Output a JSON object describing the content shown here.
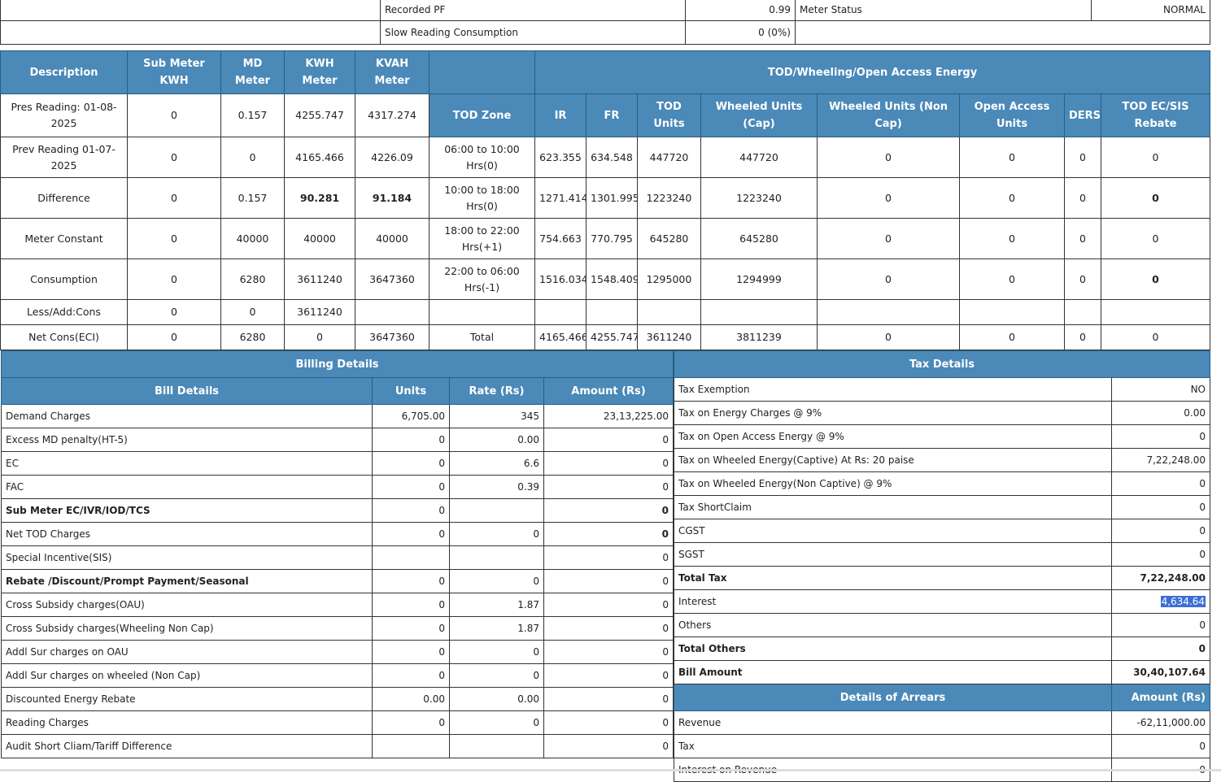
{
  "summary": {
    "rows": [
      {
        "label": "Recorded PF",
        "value": "0.99",
        "label2": "Meter Status",
        "value2": "NORMAL"
      },
      {
        "label": "Slow Reading Consumption",
        "value": "0 (0%)"
      }
    ]
  },
  "energy": {
    "headers": {
      "description": "Description",
      "sub_meter": "Sub Meter KWH",
      "md": "MD Meter",
      "kwh": "KWH Meter",
      "kvah": "KVAH Meter",
      "tod_group": "TOD/Wheeling/Open Access Energy",
      "tod_zone": "TOD Zone",
      "ir": "IR",
      "fr": "FR",
      "tod_units": "TOD Units",
      "wheeled_cap": "Wheeled Units (Cap)",
      "wheeled_noncap": "Wheeled Units (Non Cap)",
      "open_access": "Open Access Units",
      "ders": "DERS",
      "rebate": "TOD EC/SIS Rebate"
    },
    "pres": {
      "description": "Pres Reading: 01-08-2025",
      "sub_meter": "0",
      "md": "0.157",
      "kwh": "4255.747",
      "kvah": "4317.274"
    },
    "rows": [
      {
        "description": "Prev Reading 01-07-2025",
        "sub_meter": "0",
        "md": "0",
        "kwh": "4165.466",
        "kvah": "4226.09",
        "zone": "06:00  to 10:00 Hrs(0)",
        "ir": "623.355",
        "fr": "634.548",
        "tod": "447720",
        "wcap": "447720",
        "wnon": "0",
        "oa": "0",
        "ders": "0",
        "rebate": "0"
      },
      {
        "description": "Difference",
        "sub_meter": "0",
        "md": "0.157",
        "kwh": "90.281",
        "kvah": "91.184",
        "zone": "10:00  to 18:00 Hrs(0)",
        "ir": "1271.414",
        "fr": "1301.995",
        "tod": "1223240",
        "wcap": "1223240",
        "wnon": "0",
        "oa": "0",
        "ders": "0",
        "rebate": "0"
      },
      {
        "description": "Meter Constant",
        "sub_meter": "0",
        "md": "40000",
        "kwh": "40000",
        "kvah": "40000",
        "zone": "18:00  to 22:00 Hrs(+1)",
        "ir": "754.663",
        "fr": "770.795",
        "tod": "645280",
        "wcap": "645280",
        "wnon": "0",
        "oa": "0",
        "ders": "0",
        "rebate": "0"
      },
      {
        "description": "Consumption",
        "sub_meter": "0",
        "md": "6280",
        "kwh": "3611240",
        "kvah": "3647360",
        "zone": "22:00  to 06:00 Hrs(-1)",
        "ir": "1516.034",
        "fr": "1548.409",
        "tod": "1295000",
        "wcap": "1294999",
        "wnon": "0",
        "oa": "0",
        "ders": "0",
        "rebate": "0"
      },
      {
        "description": "Less/Add:Cons",
        "sub_meter": "0",
        "md": "0",
        "kwh": "3611240",
        "kvah": "",
        "zone": "",
        "ir": "",
        "fr": "",
        "tod": "",
        "wcap": "",
        "wnon": "",
        "oa": "",
        "ders": "",
        "rebate": ""
      },
      {
        "description": "Net Cons(ECI)",
        "sub_meter": "0",
        "md": "6280",
        "kwh": "0",
        "kvah": "3647360",
        "zone": "Total",
        "ir": "4165.466",
        "fr": "4255.747",
        "tod": "3611240",
        "wcap": "3811239",
        "wnon": "0",
        "oa": "0",
        "ders": "0",
        "rebate": "0"
      }
    ]
  },
  "billing": {
    "title": "Billing Details",
    "headers": [
      "Bill Details",
      "Units",
      "Rate (Rs)",
      "Amount (Rs)"
    ],
    "rows": [
      [
        "Demand Charges",
        "6,705.00",
        "345",
        "23,13,225.00"
      ],
      [
        "Excess MD penalty(HT-5)",
        "0",
        "0.00",
        "0"
      ],
      [
        "EC",
        "0",
        "6.6",
        "0"
      ],
      [
        "FAC",
        "0",
        "0.39",
        "0"
      ],
      [
        "Sub Meter EC/IVR/IOD/TCS",
        "0",
        "",
        "0"
      ],
      [
        "Net TOD Charges",
        "0",
        "0",
        "0"
      ],
      [
        "Special Incentive(SIS)",
        "",
        "",
        "0"
      ],
      [
        "Rebate /Discount/Prompt Payment/Seasonal",
        "0",
        "0",
        "0"
      ],
      [
        "Cross Subsidy charges(OAU)",
        "0",
        "1.87",
        "0"
      ],
      [
        "Cross Subsidy charges(Wheeling Non Cap)",
        "0",
        "1.87",
        "0"
      ],
      [
        "Addl Sur charges on OAU",
        "0",
        "0",
        "0"
      ],
      [
        "Addl Sur charges on wheeled (Non Cap)",
        "0",
        "0",
        "0"
      ],
      [
        "Discounted Energy Rebate",
        "0.00",
        "0.00",
        "0"
      ],
      [
        "Reading Charges",
        "0",
        "0",
        "0"
      ],
      [
        "Audit Short Cliam/Tariff Difference",
        "",
        "",
        "0"
      ]
    ]
  },
  "tax": {
    "title": "Tax Details",
    "rows": [
      [
        "Tax Exemption",
        "NO"
      ],
      [
        "Tax on Energy Charges @ 9%",
        "0.00"
      ],
      [
        "Tax on Open Access Energy @ 9%",
        "0"
      ],
      [
        "Tax on Wheeled Energy(Captive) At Rs: 20 paise",
        "7,22,248.00"
      ],
      [
        "Tax on Wheeled Energy(Non Captive) @ 9%",
        "0"
      ],
      [
        "Tax ShortClaim",
        "0"
      ],
      [
        "CGST",
        "0"
      ],
      [
        "SGST",
        "0"
      ],
      [
        "Total Tax",
        "7,22,248.00"
      ],
      [
        "Interest",
        "4,634.64"
      ],
      [
        "Others",
        "0"
      ],
      [
        "Total Others",
        "0"
      ],
      [
        "Bill Amount",
        "30,40,107.64"
      ]
    ],
    "arrears_headers": [
      "Details of Arrears",
      "Amount (Rs)"
    ],
    "arrears": [
      [
        "Revenue",
        "-62,11,000.00"
      ],
      [
        "Tax",
        "0"
      ],
      [
        "Interest on Revenue",
        "0"
      ]
    ]
  }
}
